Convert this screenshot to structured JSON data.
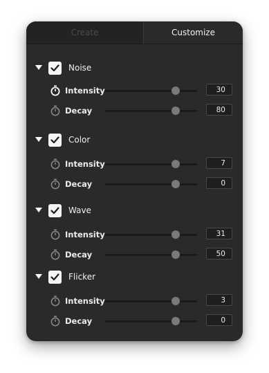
{
  "tabs": {
    "create": "Create",
    "customize": "Customize"
  },
  "sections": [
    {
      "label": "Noise",
      "checked": true,
      "params": [
        {
          "label": "Intensity",
          "value": "30",
          "icon": "stopwatch-icon-active",
          "level": 0.77
        },
        {
          "label": "Decay",
          "value": "80",
          "icon": "stopwatch-icon",
          "level": 0.77
        }
      ]
    },
    {
      "label": "Color",
      "checked": true,
      "params": [
        {
          "label": "Intensity",
          "value": "7",
          "icon": "stopwatch-icon",
          "level": 0.77
        },
        {
          "label": "Decay",
          "value": "0",
          "icon": "stopwatch-icon",
          "level": 0.77
        }
      ]
    },
    {
      "label": "Wave",
      "checked": true,
      "params": [
        {
          "label": "Intensity",
          "value": "31",
          "icon": "stopwatch-icon",
          "level": 0.77
        },
        {
          "label": "Decay",
          "value": "50",
          "icon": "stopwatch-icon",
          "level": 0.77
        }
      ]
    },
    {
      "label": "Flicker",
      "checked": true,
      "params": [
        {
          "label": "Intensity",
          "value": "3",
          "icon": "stopwatch-icon",
          "level": 0.77
        },
        {
          "label": "Decay",
          "value": "0",
          "icon": "stopwatch-icon",
          "level": 0.77
        }
      ]
    }
  ],
  "colors": {
    "panel": "#2a2a2c",
    "text": "#f0f0f0",
    "icon_active": "#ffffff",
    "icon_inactive": "#8a8a8d"
  }
}
